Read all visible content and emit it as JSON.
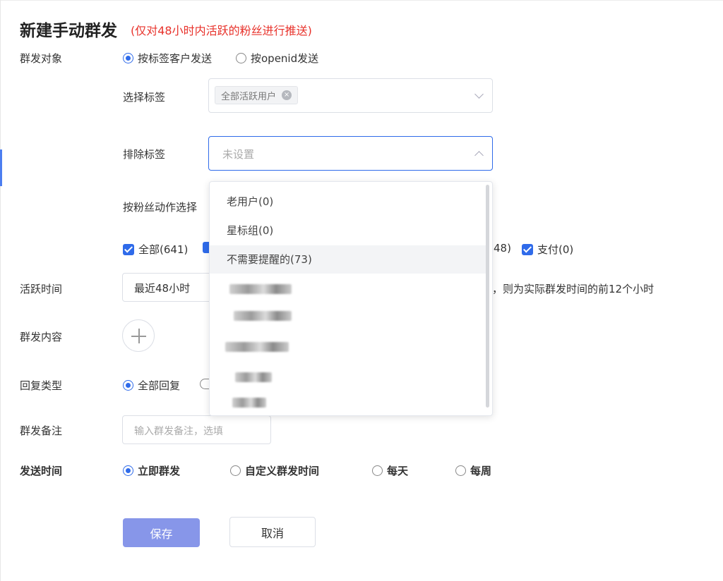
{
  "header": {
    "title": "新建手动群发",
    "subtitle": "(仅对48小时内活跃的粉丝进行推送)"
  },
  "target": {
    "label": "群发对象",
    "options": [
      "按标签客户发送",
      "按openid发送"
    ],
    "selected": "按标签客户发送"
  },
  "select_tag": {
    "label": "选择标签",
    "chip": "全部活跃用户",
    "chip_remove": "×"
  },
  "exclude_tag": {
    "label": "排除标签",
    "placeholder": "未设置"
  },
  "fan_action": {
    "label": "按粉丝动作选择",
    "checkboxes": [
      "全部(641)",
      "48)",
      "支付(0)"
    ]
  },
  "dropdown": {
    "items": [
      "老用户(0)",
      "星标组(0)",
      "不需要提醒的(73)"
    ],
    "hovered": "不需要提醒的(73)"
  },
  "active_time": {
    "label": "活跃时间",
    "value": "最近48小时",
    "hint": "，则为实际群发时间的前12个小时"
  },
  "content": {
    "label": "群发内容"
  },
  "reply_type": {
    "label": "回复类型",
    "selected": "全部回复"
  },
  "note": {
    "label": "群发备注",
    "placeholder": "输入群发备注，选填"
  },
  "send_time": {
    "label": "发送时间",
    "options": [
      "立即群发",
      "自定义群发时间",
      "每天",
      "每周"
    ],
    "selected": "立即群发"
  },
  "actions": {
    "save": "保存",
    "cancel": "取消"
  },
  "colors": {
    "accent": "#2f6bea",
    "warning": "#e8322b",
    "primary_button": "#8796e9"
  }
}
